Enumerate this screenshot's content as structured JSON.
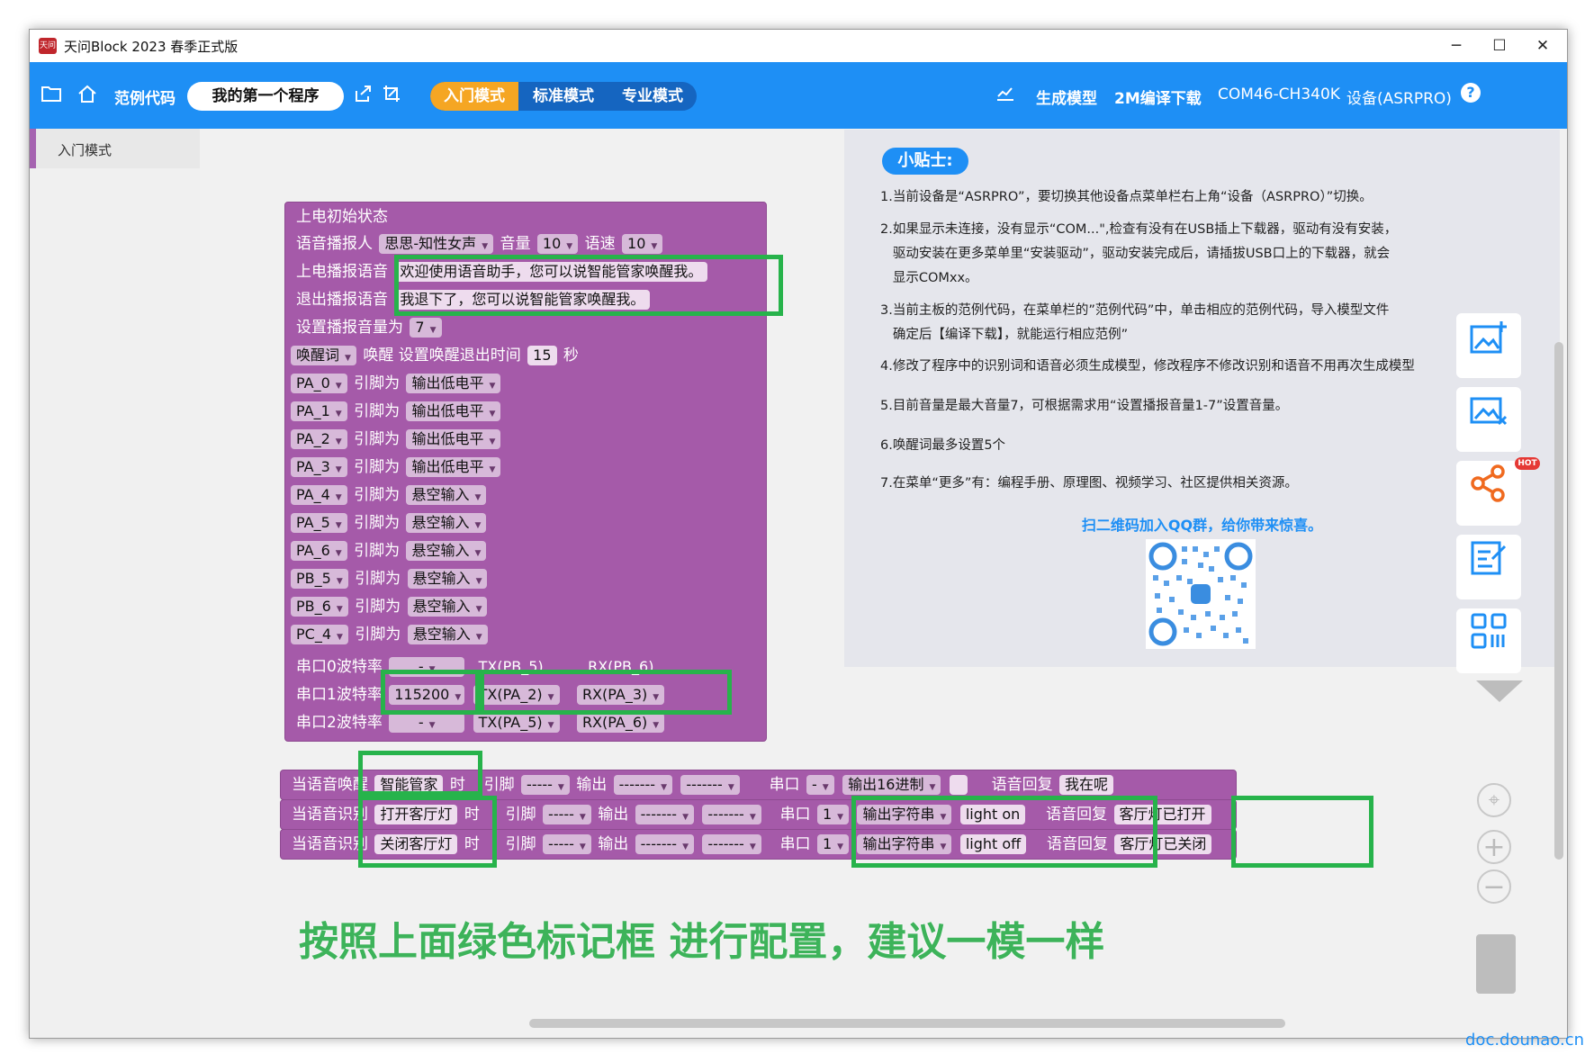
{
  "window": {
    "title": "天问Block 2023 春季正式版",
    "logo": "天问",
    "minimize": "─",
    "maximize": "☐",
    "close": "✕"
  },
  "toolbar": {
    "examples_label": "范例代码",
    "program_name": "我的第一个程序",
    "modes": {
      "beginner": "入门模式",
      "standard": "标准模式",
      "pro": "专业模式"
    },
    "generate_model": "生成模型",
    "compile_download": "2M编译下载",
    "port": "COM46-CH340K",
    "device": "设备(ASRPRO)",
    "help": "?"
  },
  "sidebar": {
    "items": [
      {
        "label": "入门模式"
      }
    ]
  },
  "tips": {
    "title": "小贴士:",
    "lines": [
      "1.当前设备是“ASRPRO”，要切换其他设备点菜单栏右上角“设备（ASRPRO）”切换。",
      "2.如果显示未连接，没有显示“COM...\",检查有没有在USB插上下载器，驱动有没有安装，",
      "   驱动安装在更多菜单里“安装驱动”，驱动安装完成后，请插拔USB口上的下载器，就会",
      "   显示COMxx。",
      "3.当前主板的范例代码，在菜单栏的”范例代码”中，单击相应的范例代码，导入模型文件",
      "   确定后【编译下载】，就能运行相应范例”",
      "4.修改了程序中的识别词和语音必须生成模型，修改程序不修改识别和语音不用再次生成模型",
      "5.目前音量是最大音量7，可根据需求用“设置播报音量1-7”设置音量。",
      "6.唤醒词最多设置5个",
      "7.在菜单“更多”有：编程手册、原理图、视频学习、社区提供相关资源。"
    ],
    "qq_link": "扫二维码加入QQ群，给你带来惊喜。"
  },
  "side_tools": {
    "hot": "HOT"
  },
  "init_block": {
    "title": "上电初始状态",
    "voice_label": "语音播报人",
    "voice": "思思-知性女声",
    "volume_label": "音量",
    "volume": "10",
    "speed_label": "语速",
    "speed": "10",
    "boot_label": "上电播报语音",
    "boot_text": "欢迎使用语音助手，您可以说智能管家唤醒我。",
    "exit_label": "退出播报语音",
    "exit_text": "我退下了，您可以说智能管家唤醒我。",
    "set_volume_label": "设置播报音量为",
    "set_volume": "7",
    "wake_word_dd": "唤醒词",
    "wake_label": "唤醒",
    "wake_timeout_label": "设置唤醒退出时间",
    "wake_timeout": "15",
    "seconds": "秒",
    "pin_label": "引脚为",
    "pins": [
      {
        "pin": "PA_0",
        "mode": "输出低电平"
      },
      {
        "pin": "PA_1",
        "mode": "输出低电平"
      },
      {
        "pin": "PA_2",
        "mode": "输出低电平"
      },
      {
        "pin": "PA_3",
        "mode": "输出低电平"
      },
      {
        "pin": "PA_4",
        "mode": "悬空输入"
      },
      {
        "pin": "PA_5",
        "mode": "悬空输入"
      },
      {
        "pin": "PA_6",
        "mode": "悬空输入"
      },
      {
        "pin": "PB_5",
        "mode": "悬空输入"
      },
      {
        "pin": "PB_6",
        "mode": "悬空输入"
      },
      {
        "pin": "PC_4",
        "mode": "悬空输入"
      }
    ],
    "serials": [
      {
        "label": "串口0波特率",
        "baud": "-",
        "tx": "TX(PB_5)",
        "rx": "RX(PB_6)"
      },
      {
        "label": "串口1波特率",
        "baud": "115200",
        "tx": "TX(PA_2)",
        "rx": "RX(PA_3)"
      },
      {
        "label": "串口2波特率",
        "baud": "-",
        "tx": "TX(PA_5)",
        "rx": "RX(PA_6)"
      }
    ]
  },
  "wake_blocks": [
    {
      "prefix": "当语音唤醒",
      "word": "智能管家",
      "suffix": "时",
      "pin_label": "引脚",
      "pin": "-----",
      "out_label": "输出",
      "out": "-------",
      "out2": "-------",
      "serial_label": "串口",
      "serial": "-",
      "format": "输出16进制",
      "data": "",
      "reply_label": "语音回复",
      "reply": "我在呢"
    },
    {
      "prefix": "当语音识别",
      "word": "打开客厅灯",
      "suffix": "时",
      "pin_label": "引脚",
      "pin": "-----",
      "out_label": "输出",
      "out": "-------",
      "out2": "-------",
      "serial_label": "串口",
      "serial": "1",
      "format": "输出字符串",
      "data": "light on",
      "reply_label": "语音回复",
      "reply": "客厅灯已打开"
    },
    {
      "prefix": "当语音识别",
      "word": "关闭客厅灯",
      "suffix": "时",
      "pin_label": "引脚",
      "pin": "-----",
      "out_label": "输出",
      "out": "-------",
      "out2": "-------",
      "serial_label": "串口",
      "serial": "1",
      "format": "输出字符串",
      "data": "light off",
      "reply_label": "语音回复",
      "reply": "客厅灯已关闭"
    }
  ],
  "instruction": "按照上面绿色标记框 进行配置，建议一模一样",
  "watermark": "doc.dounao.cn",
  "colors": {
    "toolbar": "#1e8ff5",
    "beginner_mode": "#f5a623",
    "block": "#a55aa9",
    "highlight": "#27b34b",
    "instruction": "#3db35a"
  }
}
